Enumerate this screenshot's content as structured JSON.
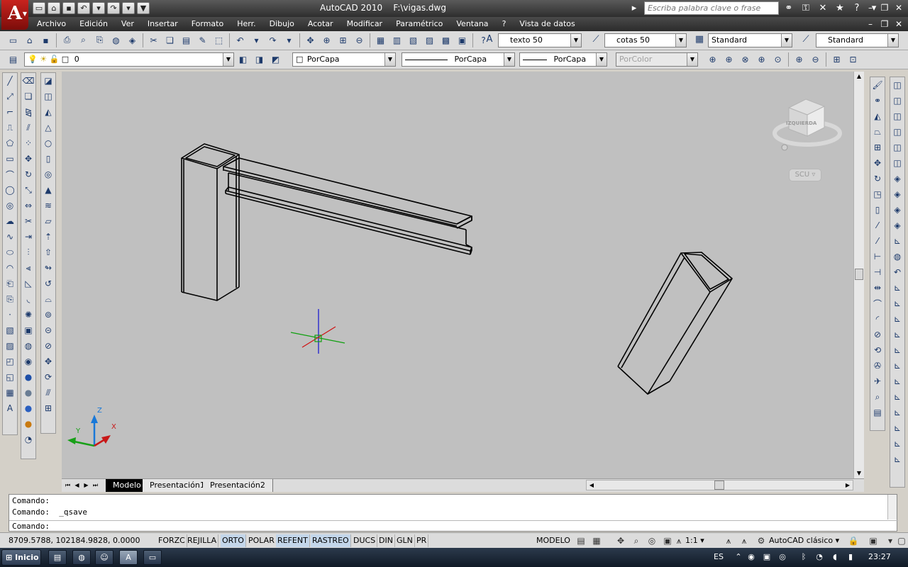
{
  "app": {
    "title": "AutoCAD 2010",
    "file": "F:\\vigas.dwg",
    "logo_letter": "A"
  },
  "help": {
    "search_placeholder": "Escriba palabra clave o frase"
  },
  "menu": [
    "Archivo",
    "Edición",
    "Ver",
    "Insertar",
    "Formato",
    "Herr.",
    "Dibujo",
    "Acotar",
    "Modificar",
    "Paramétrico",
    "Ventana",
    "?",
    "Vista de datos"
  ],
  "styles": {
    "text_style": "texto 50",
    "dim_style": "cotas 50",
    "table_style": "Standard",
    "multileader_style": "Standard"
  },
  "layers": {
    "current_layer": "0",
    "color": "PorCapa",
    "linetype": "PorCapa",
    "lineweight": "PorCapa",
    "plotstyle": "PorColor"
  },
  "viewcube": {
    "face_label": "IZQUIERDA",
    "ucs_label": "SCU"
  },
  "ucs_axes": {
    "x": "X",
    "y": "Y",
    "z": "Z"
  },
  "tabs": [
    "Modelo",
    "Presentación1",
    "Presentación2"
  ],
  "command_history": [
    "Comando:",
    "Comando:  _qsave"
  ],
  "command_prompt": "Comando:",
  "status": {
    "coordinates": "8709.5788, 102184.9828, 0.0000",
    "toggles": [
      {
        "label": "FORZC",
        "on": false
      },
      {
        "label": "REJILLA",
        "on": false
      },
      {
        "label": "ORTO",
        "on": true
      },
      {
        "label": "POLAR",
        "on": false
      },
      {
        "label": "REFENT",
        "on": true
      },
      {
        "label": "RASTREO",
        "on": true
      },
      {
        "label": "DUCS",
        "on": false
      },
      {
        "label": "DIN",
        "on": false
      },
      {
        "label": "GLN",
        "on": false
      },
      {
        "label": "PR",
        "on": false
      }
    ],
    "model": "MODELO",
    "annotation_scale": "1:1",
    "workspace": "AutoCAD clásico"
  },
  "taskbar": {
    "start_label": "Inicio",
    "language": "ES",
    "clock": "23:27"
  },
  "colors": {
    "drawing_bg": "#c0c0c0",
    "geometry": "#000000",
    "crosshair_x": "#d01010",
    "crosshair_y": "#1010d0",
    "crosshair_z": "#10a010",
    "toggle_on": "#c3d6ea"
  }
}
